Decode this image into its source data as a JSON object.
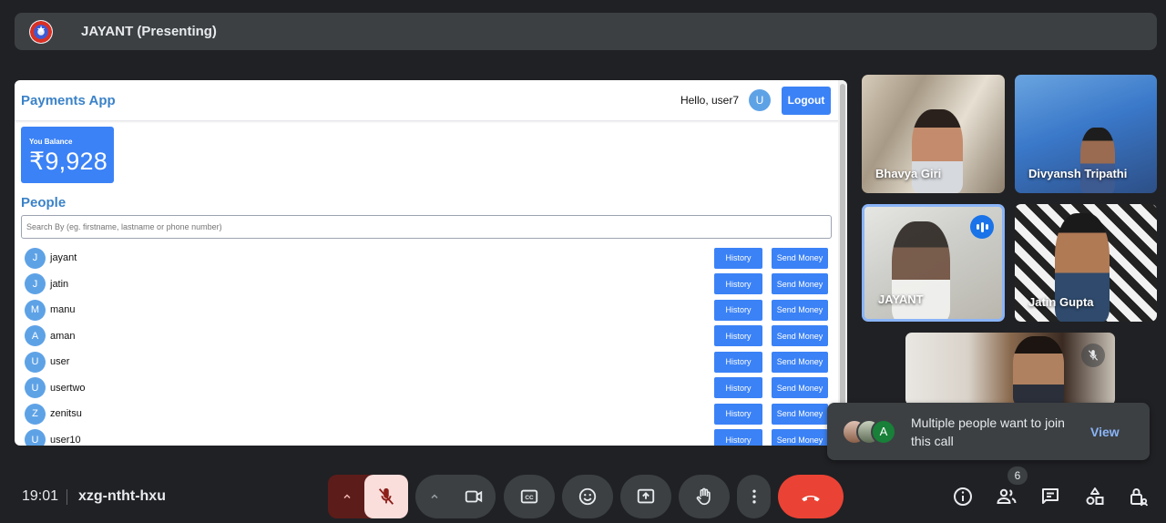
{
  "topbar": {
    "title": "JAYANT (Presenting)",
    "avatar_icon": "captain-shield-icon"
  },
  "shared_screen": {
    "app_title": "Payments App",
    "greeting": "Hello, user7",
    "user_initial": "U",
    "logout_label": "Logout",
    "balance_label": "You Balance",
    "balance_amount": "₹9,928",
    "people_heading": "People",
    "search_placeholder": "Search By (eg. firstname, lastname or phone number)",
    "history_label": "History",
    "send_label": "Send Money",
    "people": [
      {
        "initial": "J",
        "name": "jayant"
      },
      {
        "initial": "J",
        "name": "jatin"
      },
      {
        "initial": "M",
        "name": "manu"
      },
      {
        "initial": "A",
        "name": "aman"
      },
      {
        "initial": "U",
        "name": "user"
      },
      {
        "initial": "U",
        "name": "usertwo"
      },
      {
        "initial": "Z",
        "name": "zenitsu"
      },
      {
        "initial": "U",
        "name": "user10"
      }
    ]
  },
  "participants": [
    {
      "name": "Bhavya Giri"
    },
    {
      "name": "Divyansh Tripathi"
    },
    {
      "name": "JAYANT",
      "speaking": true
    },
    {
      "name": "Jatin Gupta"
    },
    {
      "name": "",
      "muted": true
    }
  ],
  "notification": {
    "message": "Multiple people want to join this call",
    "action": "View",
    "avatar_initial": "A"
  },
  "bottom_bar": {
    "time": "19:01",
    "meeting_code": "xzg-ntht-hxu",
    "participant_count": "6"
  },
  "colors": {
    "accent": "#3b82f6",
    "end_call": "#ea4335",
    "link": "#8ab4f8"
  }
}
